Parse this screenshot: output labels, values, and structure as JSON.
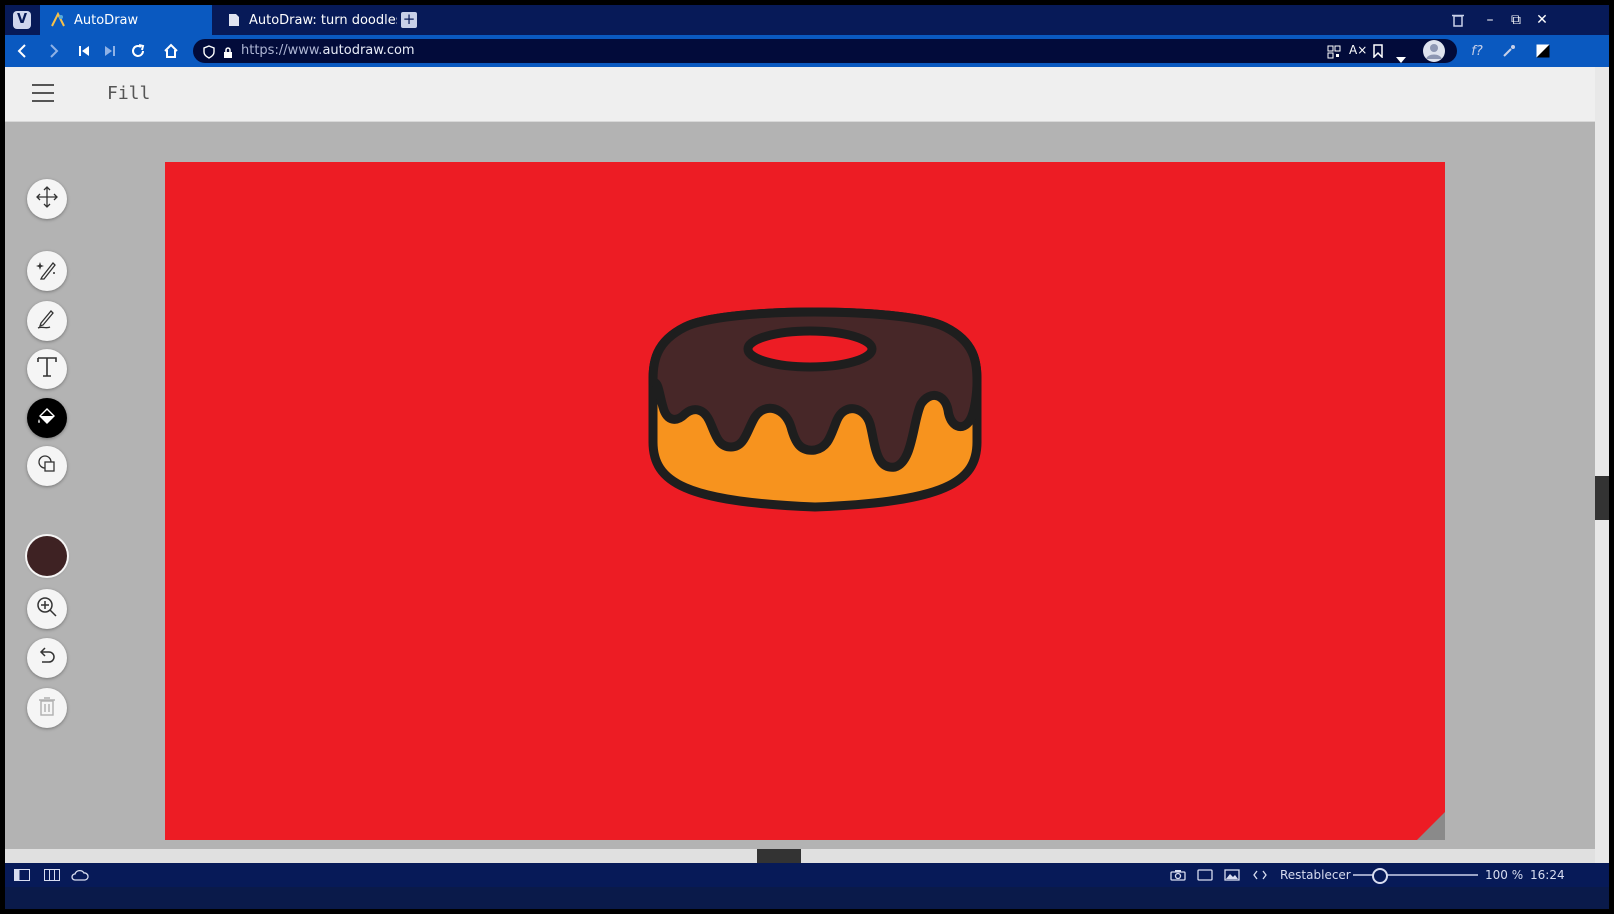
{
  "browser": {
    "tabs": [
      {
        "title": "AutoDraw",
        "active": true
      },
      {
        "title": "AutoDraw: turn doodles in",
        "active": false
      }
    ],
    "url": "https://www.autodraw.com",
    "url_prefix": "https://www.",
    "url_domain": "autodraw.com"
  },
  "app": {
    "mode_title": "Fill",
    "tools": [
      {
        "name": "move",
        "icon": "move-arrows-icon",
        "active": false
      },
      {
        "name": "autodraw",
        "icon": "sparkle-pen-icon",
        "active": false
      },
      {
        "name": "draw",
        "icon": "pencil-icon",
        "active": false
      },
      {
        "name": "type",
        "icon": "text-t-icon",
        "active": false
      },
      {
        "name": "fill",
        "icon": "paint-bucket-icon",
        "active": true
      },
      {
        "name": "shape",
        "icon": "shapes-icon",
        "active": false
      }
    ],
    "current_color": "#3e2223",
    "actions": [
      {
        "name": "zoom",
        "icon": "zoom-in-icon"
      },
      {
        "name": "undo",
        "icon": "undo-icon"
      },
      {
        "name": "delete",
        "icon": "trash-icon",
        "disabled": true
      }
    ],
    "canvas": {
      "background_color": "#ed1c24",
      "drawing": "donut",
      "donut_colors": {
        "icing": "#472728",
        "dough": "#f7931e",
        "outline": "#1e1e1e"
      }
    }
  },
  "statusbar": {
    "reset_label": "Restablecer",
    "zoom": "100 %",
    "time": "16:24"
  }
}
